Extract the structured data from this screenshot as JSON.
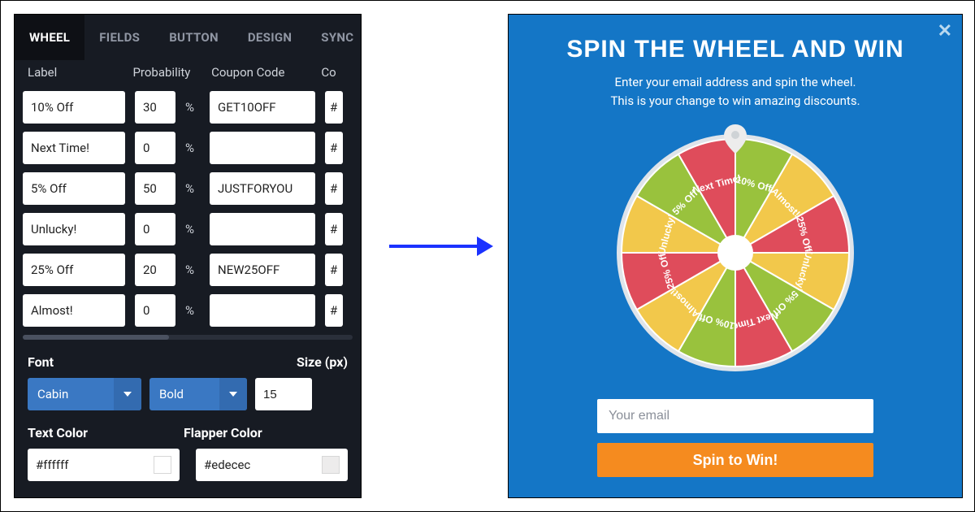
{
  "tabs": [
    "WHEEL",
    "FIELDS",
    "BUTTON",
    "DESIGN",
    "SYNC"
  ],
  "active_tab": "WHEEL",
  "columns": {
    "label": "Label",
    "prob": "Probability",
    "coupon": "Coupon Code",
    "color": "Co"
  },
  "pct": "%",
  "hash": "#",
  "rows": [
    {
      "label": "10% Off",
      "prob": "30",
      "coupon": "GET10OFF"
    },
    {
      "label": "Next Time!",
      "prob": "0",
      "coupon": ""
    },
    {
      "label": "5% Off",
      "prob": "50",
      "coupon": "JUSTFORYOU"
    },
    {
      "label": "Unlucky!",
      "prob": "0",
      "coupon": ""
    },
    {
      "label": "25% Off",
      "prob": "20",
      "coupon": "NEW25OFF"
    },
    {
      "label": "Almost!",
      "prob": "0",
      "coupon": ""
    }
  ],
  "font_label": "Font",
  "size_label": "Size (px)",
  "font_value": "Cabin",
  "weight_value": "Bold",
  "size_value": "15",
  "textcolor_label": "Text Color",
  "flapper_label": "Flapper Color",
  "text_color": "#ffffff",
  "flapper_color": "#edecec",
  "preview": {
    "title": "SPIN THE WHEEL AND WIN",
    "line1": "Enter your email address and spin the wheel.",
    "line2": "This is your change to win amazing discounts.",
    "email_placeholder": "Your email",
    "button": "Spin to Win!"
  },
  "wheel": {
    "slice_colors": [
      "#99C23D",
      "#F2C84B",
      "#DF4C5B",
      "#F2C84B",
      "#99C23D",
      "#DF4C5B",
      "#99C23D",
      "#F2C84B",
      "#DF4C5B",
      "#F2C84B",
      "#99C23D",
      "#DF4C5B"
    ],
    "labels": [
      "10% Off",
      "Almost!",
      "25% Off",
      "Unlucky!",
      "5% Off",
      "Next Time!",
      "10% Off",
      "Almost!",
      "25% Off",
      "Unlucky!",
      "5% Off",
      "Next Time!"
    ],
    "pointer_color": "#edecec",
    "hub_color": "#ffffff",
    "rim_color": "#dfe4ea"
  }
}
